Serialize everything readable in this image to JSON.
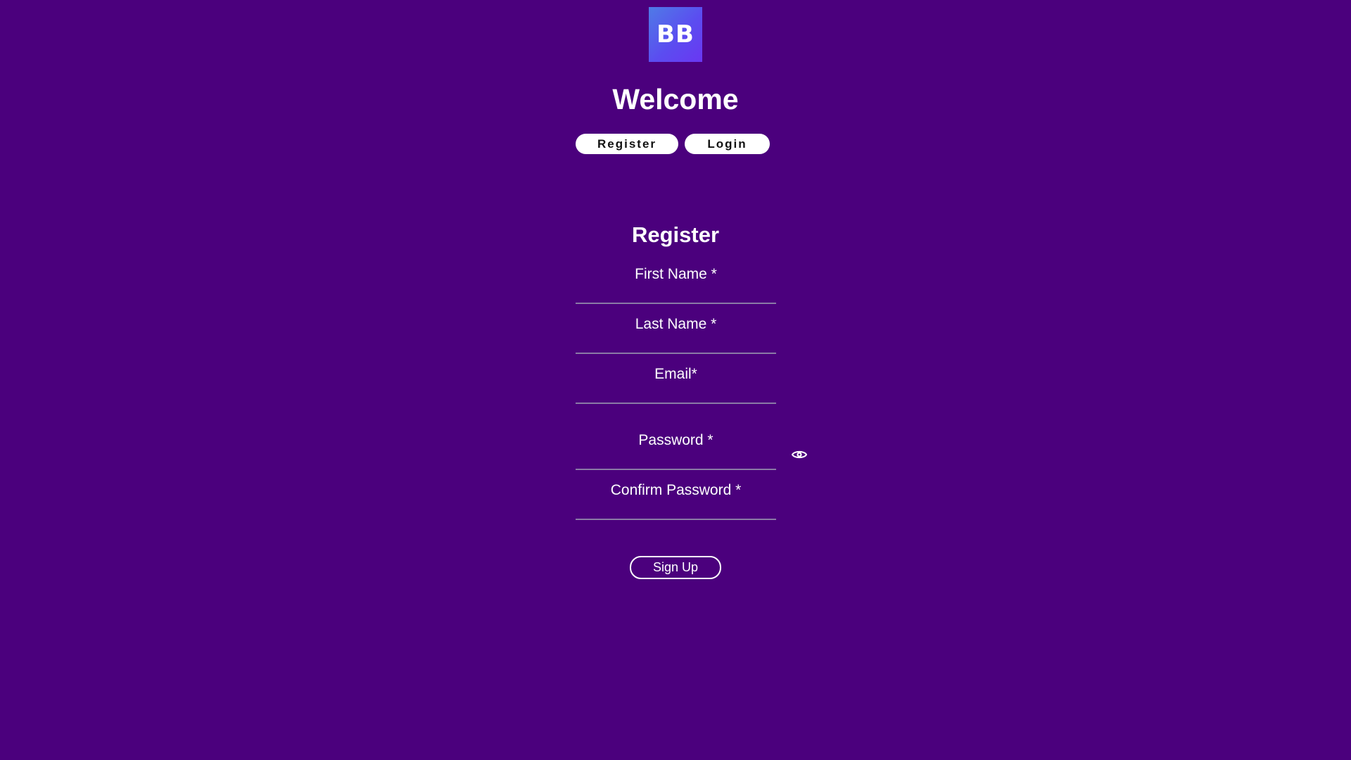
{
  "brand": {
    "logo_text": "BB",
    "colors": {
      "background": "#4b007d",
      "logo_gradient_start": "#4f7be6",
      "logo_gradient_end": "#6a37f2",
      "text": "#ffffff",
      "underline": "#8a7aa6"
    }
  },
  "header": {
    "title": "Welcome",
    "tabs": [
      {
        "label": "Register"
      },
      {
        "label": "Login"
      }
    ]
  },
  "form": {
    "title": "Register",
    "fields": {
      "first_name": {
        "label": "First Name *",
        "value": ""
      },
      "last_name": {
        "label": "Last Name *",
        "value": ""
      },
      "email": {
        "label": "Email*",
        "value": ""
      },
      "password": {
        "label": "Password *",
        "value": "",
        "toggle_icon": "eye-icon"
      },
      "confirm_password": {
        "label": "Confirm Password *",
        "value": ""
      }
    },
    "submit_label": "Sign Up"
  }
}
